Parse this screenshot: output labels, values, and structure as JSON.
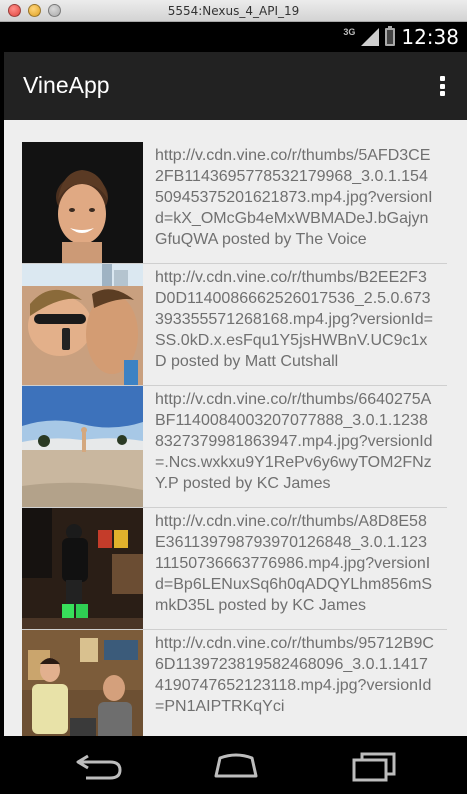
{
  "window": {
    "title": "5554:Nexus_4_API_19"
  },
  "status_bar": {
    "network": "3G",
    "time": "12:38"
  },
  "action_bar": {
    "title": "VineApp",
    "overflow_icon": "more-vert-icon"
  },
  "feed": {
    "items": [
      {
        "caption": "http://v.cdn.vine.co/r/thumbs/5AFD3CE2FB1143695778532179968_3.0.1.15450945375201621873.mp4.jpg?versionId=kX_OMcGb4eMxWBMADeJ.bGajynGfuQWA posted by The Voice"
      },
      {
        "caption": "http://v.cdn.vine.co/r/thumbs/B2EE2F3D0D1140086662526017536_2.5.0.6733933555712681​68.mp4.jpg?versionId=SS.0kD.x.esFqu1Y5jsHWBnV.UC9c1xD posted by Matt Cutshall"
      },
      {
        "caption": "http://v.cdn.vine.co/r/thumbs/6640275ABF1140084003207077888_3.0.1.12388327379981863947.mp4.jpg?versionId=.Ncs.wxkxu9Y1RePv6y6wyTOM2FNzY.P posted by KC James"
      },
      {
        "caption": "http://v.cdn.vine.co/r/thumbs/A8D8E58E3611397987939701268​48_3.0.1.12311150736663776986.mp4.jpg?versionId=Bp6LENuxSq6h0qADQYLhm856mSmkD35L posted by KC James"
      },
      {
        "caption": "http://v.cdn.vine.co/r/thumbs/95712B9C6D1139723819582468096_3.0.1.14174190747652123118.mp4.jpg?versionId=PN1AIPTRKqYci"
      }
    ]
  },
  "nav_bar": {
    "back_icon": "back-icon",
    "home_icon": "home-icon",
    "recents_icon": "recents-icon"
  }
}
